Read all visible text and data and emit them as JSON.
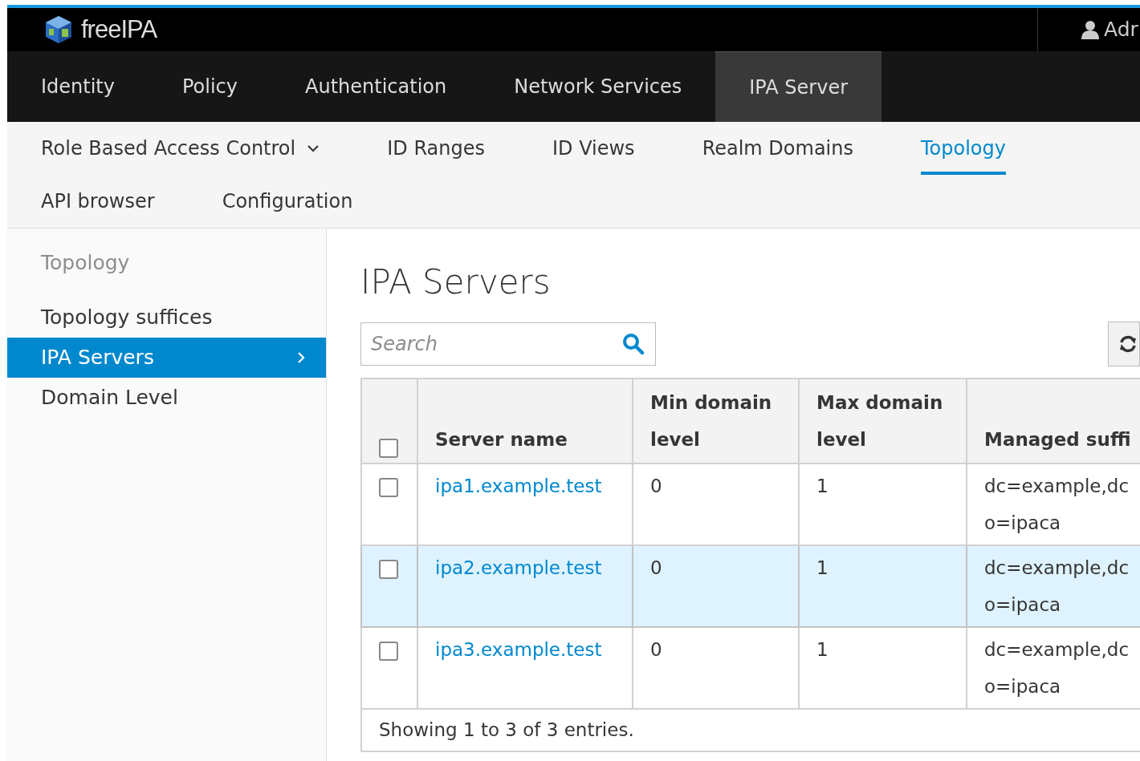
{
  "brand": {
    "name": "freeIPA"
  },
  "user_menu": {
    "label": "Adr"
  },
  "main_nav": [
    {
      "label": "Identity",
      "selected": false
    },
    {
      "label": "Policy",
      "selected": false
    },
    {
      "label": "Authentication",
      "selected": false
    },
    {
      "label": "Network Services",
      "selected": false
    },
    {
      "label": "IPA Server",
      "selected": true
    }
  ],
  "sub_nav": [
    {
      "label": "Role Based Access Control",
      "kind": "dropdown",
      "selected": false
    },
    {
      "label": "ID Ranges",
      "kind": "link",
      "selected": false
    },
    {
      "label": "ID Views",
      "kind": "link",
      "selected": false
    },
    {
      "label": "Realm Domains",
      "kind": "link",
      "selected": false
    },
    {
      "label": "Topology",
      "kind": "link",
      "selected": true
    },
    {
      "label": "API browser",
      "kind": "link",
      "selected": false
    },
    {
      "label": "Configuration",
      "kind": "link",
      "selected": false
    }
  ],
  "sidebar": {
    "items": [
      {
        "label": "Topology",
        "kind": "heading",
        "selected": false
      },
      {
        "label": "Topology suffices",
        "kind": "link",
        "selected": false
      },
      {
        "label": "IPA Servers",
        "kind": "link",
        "selected": true
      },
      {
        "label": "Domain Level",
        "kind": "link",
        "selected": false
      }
    ]
  },
  "page_title": "IPA Servers",
  "search": {
    "placeholder": "Search"
  },
  "table": {
    "columns": [
      "Server name",
      "Min domain level",
      "Max domain level",
      "Managed suffi"
    ],
    "select_all": {
      "checked": false
    },
    "rows": [
      {
        "checked": false,
        "selected": false,
        "cells": [
          "ipa1.example.test",
          "0",
          "1",
          "dc=example,dc"
        ],
        "extra": "o=ipaca"
      },
      {
        "checked": false,
        "selected": true,
        "cells": [
          "ipa2.example.test",
          "0",
          "1",
          "dc=example,dc"
        ],
        "extra": "o=ipaca"
      },
      {
        "checked": false,
        "selected": false,
        "cells": [
          "ipa3.example.test",
          "0",
          "1",
          "dc=example,dc"
        ],
        "extra": "o=ipaca"
      }
    ],
    "footer": "Showing 1 to 3 of 3 entries."
  }
}
